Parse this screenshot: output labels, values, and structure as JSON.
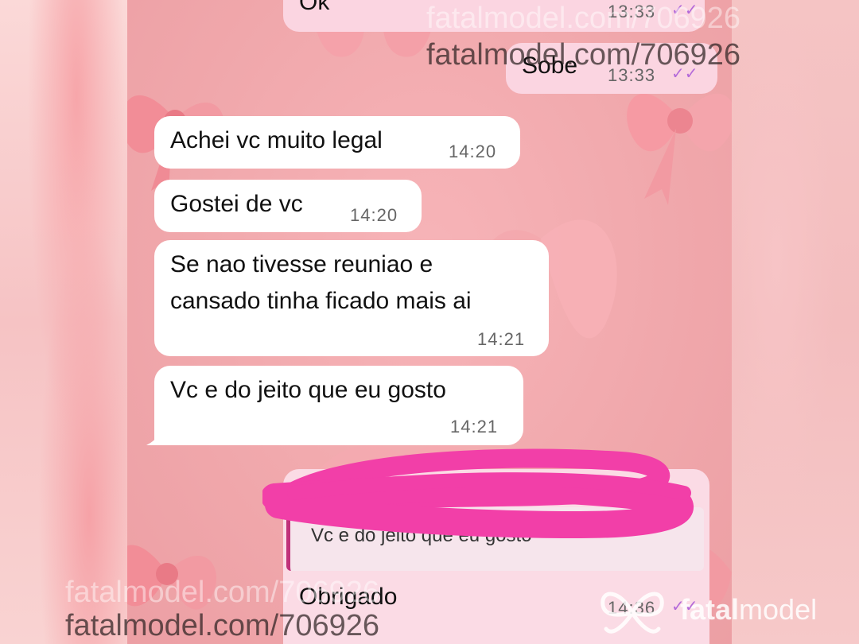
{
  "messages": [
    {
      "text": "Ok",
      "time": "13:33",
      "direction": "out",
      "read": true
    },
    {
      "text": "Sobe",
      "time": "13:33",
      "direction": "out",
      "read": true
    },
    {
      "text": "Achei vc muito legal",
      "time": "14:20",
      "direction": "in"
    },
    {
      "text": "Gostei de vc",
      "time": "14:20",
      "direction": "in"
    },
    {
      "text": "Se nao tivesse reuniao e\ncansado tinha ficado mais ai",
      "time": "14:21",
      "direction": "in"
    },
    {
      "text": "Vc e  do jeito que eu gosto",
      "time": "14:21",
      "direction": "in"
    },
    {
      "text": "Obrigado",
      "time": "14:36",
      "direction": "out",
      "read": true,
      "reply_to": "Vc e  do jeito que eu gosto"
    }
  ],
  "watermarks": {
    "url": "fatalmodel.com/706926",
    "brand_prefix": "fatal",
    "brand_suffix": "model"
  },
  "colors": {
    "background_pink": "#f0a7ab",
    "incoming_bubble": "#ffffff",
    "outgoing_bubble": "#fbd5e1",
    "read_ticks": "#b46ad9",
    "redaction_scribble": "#f23fa8"
  },
  "icons": {
    "read_receipt": "double-check-icon",
    "brand_logo": "butterfly-icon"
  }
}
